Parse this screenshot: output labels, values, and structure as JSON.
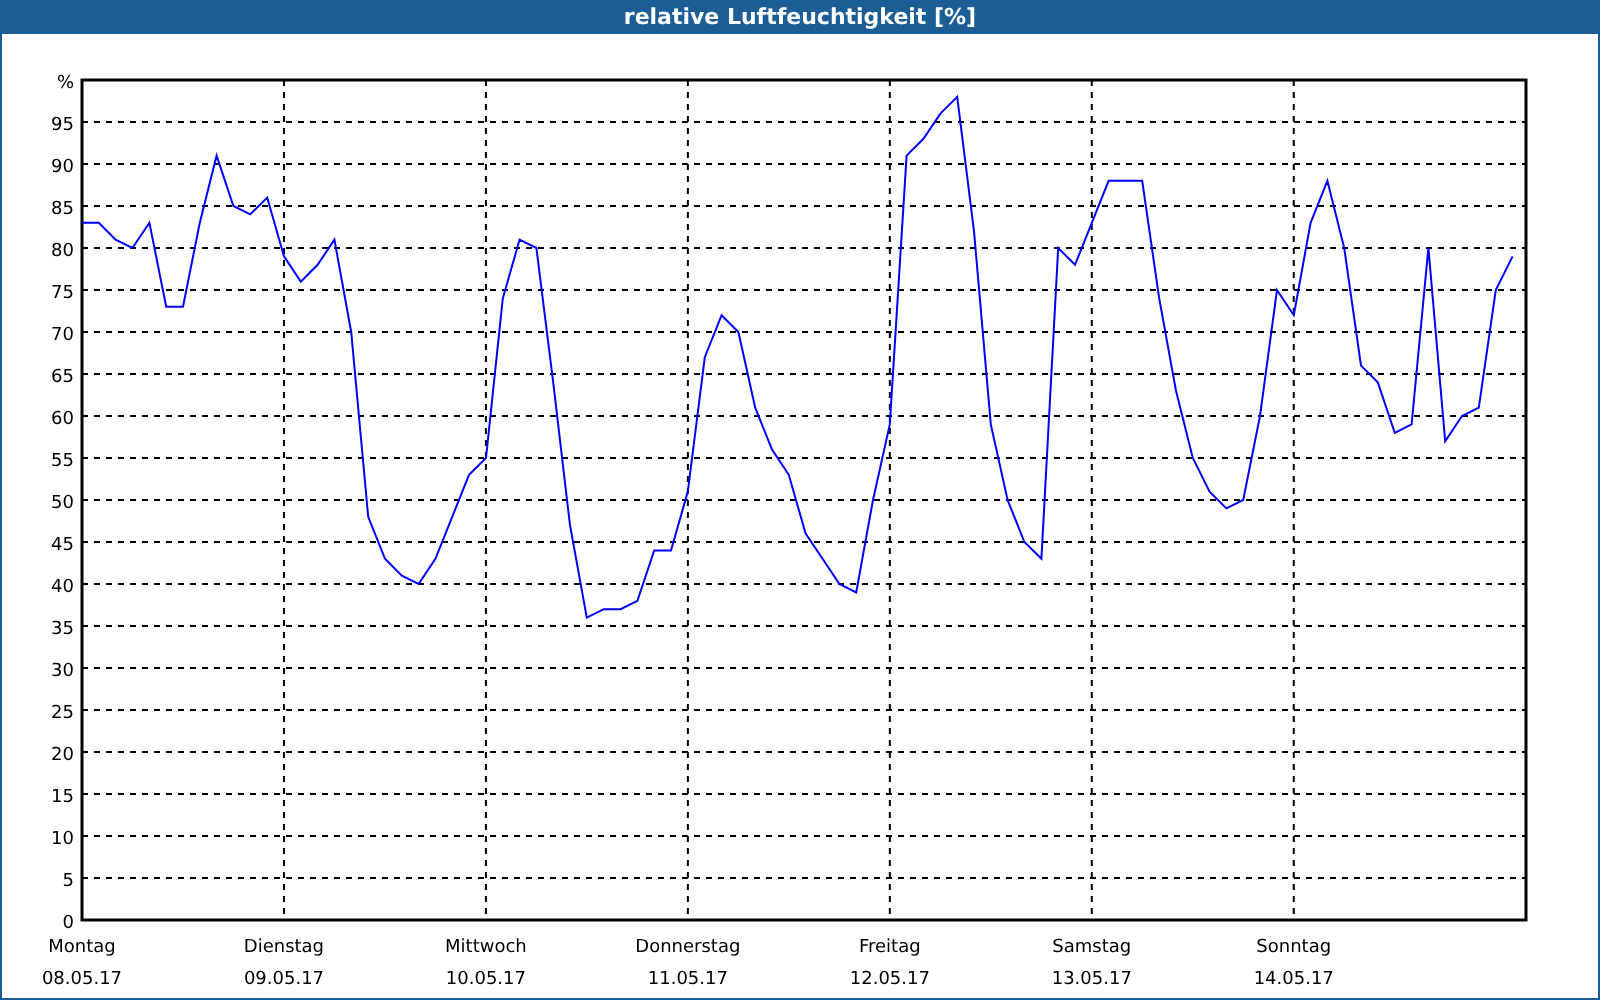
{
  "window": {
    "title": "relative Luftfeuchtigkeit [%]"
  },
  "chart": {
    "day_labels": [
      "Montag",
      "Dienstag",
      "Mittwoch",
      "Donnerstag",
      "Freitag",
      "Samstag",
      "Sonntag"
    ],
    "chart_data": {
      "type": "line",
      "grid": true,
      "ylim": [
        0,
        100
      ],
      "yticks": [
        0,
        5,
        10,
        15,
        20,
        25,
        30,
        35,
        40,
        45,
        50,
        55,
        60,
        65,
        70,
        75,
        80,
        85,
        90,
        95,
        {
          "value": 100,
          "label": "%"
        }
      ],
      "categories": [
        "08.05.17",
        null,
        null,
        null,
        null,
        null,
        null,
        null,
        null,
        null,
        null,
        null,
        "09.05.17",
        null,
        null,
        null,
        null,
        null,
        null,
        null,
        null,
        null,
        null,
        null,
        "10.05.17",
        null,
        null,
        null,
        null,
        null,
        null,
        null,
        null,
        null,
        null,
        null,
        "11.05.17",
        null,
        null,
        null,
        null,
        null,
        null,
        null,
        null,
        null,
        null,
        null,
        "12.05.17",
        null,
        null,
        null,
        null,
        null,
        null,
        null,
        null,
        null,
        null,
        null,
        "13.05.17",
        null,
        null,
        null,
        null,
        null,
        null,
        null,
        null,
        null,
        null,
        null,
        "14.05.17",
        null,
        null,
        null,
        null,
        null,
        null,
        null,
        null,
        null,
        null,
        null,
        null,
        null
      ],
      "series": [
        {
          "color": "#0000ff",
          "values": [
            83,
            83,
            81,
            80,
            83,
            73,
            73,
            83,
            91,
            85,
            84,
            86,
            79,
            76,
            78,
            81,
            70,
            48,
            43,
            41,
            40,
            43,
            48,
            53,
            55,
            74,
            81,
            80,
            64,
            47,
            36,
            37,
            37,
            38,
            44,
            44,
            51,
            67,
            72,
            70,
            61,
            56,
            53,
            46,
            43,
            40,
            39,
            50,
            59,
            91,
            93,
            96,
            98,
            82,
            59,
            50,
            45,
            43,
            80,
            78,
            83,
            88,
            88,
            88,
            74,
            63,
            55,
            51,
            49,
            50,
            60,
            75,
            72,
            83,
            88,
            80,
            66,
            64,
            58,
            59,
            80,
            57,
            60,
            61,
            75,
            79
          ]
        }
      ]
    }
  }
}
